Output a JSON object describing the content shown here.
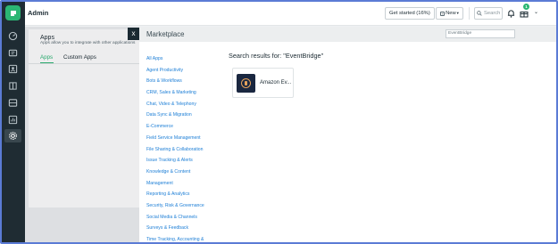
{
  "app": {
    "title": "Admin"
  },
  "header": {
    "get_started_label": "Get started (16%)",
    "new_label": "New",
    "search_label": "Search",
    "gift_badge": "1"
  },
  "admin_page": {
    "apps_title": "Apps",
    "apps_description": "Apps allow you to integrate with other applications",
    "tabs": [
      {
        "label": "Apps",
        "active": true
      },
      {
        "label": "Custom Apps",
        "active": false
      }
    ]
  },
  "rail": {
    "icons": [
      "logo-icon",
      "dashboard-icon",
      "tickets-icon",
      "contacts-icon",
      "knowledge-base-icon",
      "inbox-icon",
      "reports-icon",
      "admin-gear-icon"
    ]
  },
  "modal": {
    "close_label": "x",
    "title": "Marketplace",
    "search_value": "EventBridge",
    "results_title": "Search results for: \"EventBridge\"",
    "categories": [
      "All Apps",
      "Agent Productivity",
      "Bots & Workflows",
      "CRM, Sales & Marketing",
      "Chat, Video & Telephony",
      "Data Sync & Migration",
      "E-Commerce",
      "Field Service Management",
      "File Sharing & Collaboration",
      "Issue Tracking & Alerts",
      "Knowledge & Content",
      "Management",
      "Reporting & Analytics",
      "Security, Risk & Governance",
      "Social Media & Channels",
      "Surveys & Feedback",
      "Time Tracking, Accounting &"
    ],
    "results": [
      {
        "name": "Amazon Ev...",
        "logo": "amazon-eventbridge-logo"
      }
    ]
  },
  "colors": {
    "brand_green": "#2bb673",
    "rail_bg": "#1f2c33",
    "link_blue": "#1c7ed6",
    "frame_border": "#5b7bd5"
  }
}
